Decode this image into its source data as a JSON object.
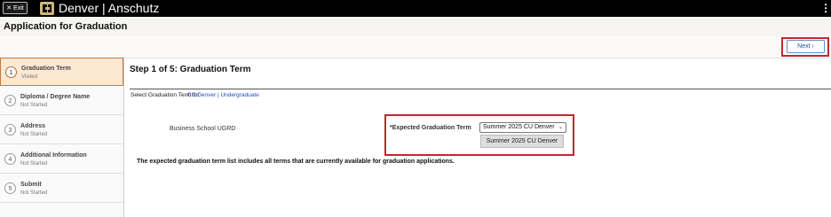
{
  "topbar": {
    "exit_label": "✕ Exit",
    "brand": "Denver | Anschutz",
    "logo_icon": "cu-logo-icon",
    "menu_icon": "kebab-menu-icon"
  },
  "page": {
    "title": "Application for Graduation"
  },
  "nav": {
    "next_label": "Next ›"
  },
  "sidebar": {
    "steps": [
      {
        "number": "1",
        "label": "Graduation Term",
        "status": "Visited"
      },
      {
        "number": "2",
        "label": "Diploma / Degree Name",
        "status": "Not Started"
      },
      {
        "number": "3",
        "label": "Address",
        "status": "Not Started"
      },
      {
        "number": "4",
        "label": "Additional Information",
        "status": "Not Started"
      },
      {
        "number": "5",
        "label": "Submit",
        "status": "Not Started"
      }
    ]
  },
  "main": {
    "title": "Step 1 of 5: Graduation Term",
    "select_term_text": "Select Graduation Term for",
    "career_link": "CU Denver | Undergraduate",
    "program": "Business School UGRD",
    "term_field_label": "*Expected Graduation Term",
    "term_selected": "Summer 2025 CU Denver",
    "term_options": [
      "Summer 2025 CU Denver"
    ],
    "note": "The expected graduation term list includes all terms that are currently available for graduation applications."
  },
  "colors": {
    "topbar": "#000000",
    "highlight": "#c3272e",
    "link": "#1a4fc4",
    "active_step": "#fde8d4"
  }
}
